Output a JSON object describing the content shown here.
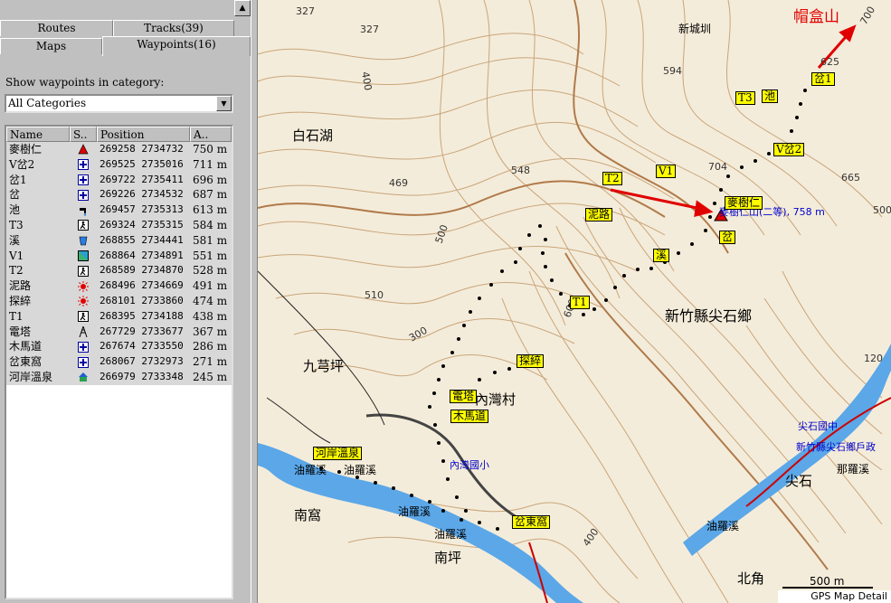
{
  "sidebar": {
    "tabs_top": [
      "Routes",
      "Tracks(39)"
    ],
    "tabs_bottom": [
      "Maps",
      "Waypoints(16)"
    ],
    "category_label": "Show waypoints in category:",
    "category_value": "All Categories",
    "columns": [
      "Name",
      "S..",
      "Position",
      "A.."
    ],
    "waypoints": [
      {
        "name": "麥樹仁",
        "symbol": "red-triangle-icon",
        "position": "269258 2734732",
        "alt": "750 m"
      },
      {
        "name": "V岔2",
        "symbol": "blue-cross-icon",
        "position": "269525 2735016",
        "alt": "711 m"
      },
      {
        "name": "岔1",
        "symbol": "blue-cross-icon",
        "position": "269722 2735411",
        "alt": "696 m"
      },
      {
        "name": "岔",
        "symbol": "blue-cross-icon",
        "position": "269226 2734532",
        "alt": "687 m"
      },
      {
        "name": "池",
        "symbol": "water-tap-icon",
        "position": "269457 2735313",
        "alt": "613 m"
      },
      {
        "name": "T3",
        "symbol": "hiker-icon",
        "position": "269324 2735315",
        "alt": "584 m"
      },
      {
        "name": "溪",
        "symbol": "water-cup-icon",
        "position": "268855 2734441",
        "alt": "581 m"
      },
      {
        "name": "V1",
        "symbol": "flag-icon",
        "position": "268864 2734891",
        "alt": "551 m"
      },
      {
        "name": "T2",
        "symbol": "hiker-icon",
        "position": "268589 2734870",
        "alt": "528 m"
      },
      {
        "name": "泥路",
        "symbol": "sun-icon",
        "position": "268496 2734669",
        "alt": "491 m"
      },
      {
        "name": "探綷",
        "symbol": "sun-icon",
        "position": "268101 2733860",
        "alt": "474 m"
      },
      {
        "name": "T1",
        "symbol": "hiker-icon",
        "position": "268395 2734188",
        "alt": "438 m"
      },
      {
        "name": "電塔",
        "symbol": "tower-icon",
        "position": "267729 2733677",
        "alt": "367 m"
      },
      {
        "name": "木馬道",
        "symbol": "blue-cross-icon",
        "position": "267674 2733550",
        "alt": "286 m"
      },
      {
        "name": "岔東窩",
        "symbol": "blue-cross-icon",
        "position": "268067 2732973",
        "alt": "271 m"
      },
      {
        "name": "河岸溫泉",
        "symbol": "house-icon",
        "position": "266979 2733348",
        "alt": "245 m"
      }
    ]
  },
  "map": {
    "title_label": "帽盒山",
    "summit_label": "麥樹仁山(二等), 758 m",
    "township": "新竹縣尖石鄉",
    "places": [
      "白石湖",
      "九芎坪",
      "內灣村",
      "油羅溪",
      "南窩",
      "南坪",
      "尖石",
      "北角",
      "新城圳",
      "那羅溪",
      "尖石國中",
      "新竹縣尖石鄉戶政",
      "內灣國小"
    ],
    "waypoint_labels": [
      "T3",
      "池",
      "岔1",
      "V岔2",
      "T2",
      "V1",
      "麥樹仁",
      "泥路",
      "岔",
      "溪",
      "T1",
      "探綷",
      "電塔",
      "木馬道",
      "河岸溫泉",
      "岔東窩"
    ],
    "contour_labels": [
      "327",
      "327",
      "400",
      "594",
      "548",
      "469",
      "500",
      "510",
      "300",
      "600",
      "704",
      "665",
      "625",
      "700",
      "500",
      "400",
      "120"
    ],
    "scale_label": "500 m",
    "status": "GPS Map Detail"
  }
}
